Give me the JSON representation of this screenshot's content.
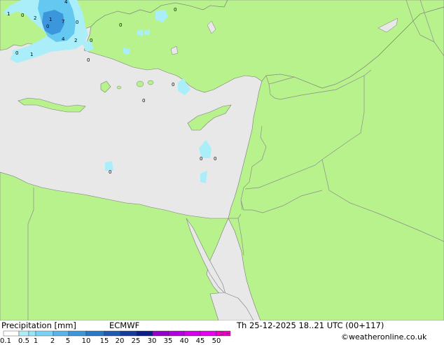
{
  "colors": {
    "land": "#b8f28c",
    "sea": "#e8e8e8",
    "border": "#8c8c8c",
    "coast": "#7a7a7a",
    "precip_light": "#aaeefa",
    "precip_mid": "#64c8f0",
    "precip_heavy": "#3c96dc"
  },
  "point_values": [
    {
      "text": "1"
    },
    {
      "text": "0"
    },
    {
      "text": "4"
    },
    {
      "text": "0"
    },
    {
      "text": "2"
    },
    {
      "text": "7"
    },
    {
      "text": "0"
    },
    {
      "text": "1"
    },
    {
      "text": "4"
    },
    {
      "text": "2"
    },
    {
      "text": "0"
    },
    {
      "text": "0"
    },
    {
      "text": "0"
    },
    {
      "text": "1"
    },
    {
      "text": "0"
    },
    {
      "text": "0"
    },
    {
      "text": "0"
    },
    {
      "text": "0"
    },
    {
      "text": "0"
    },
    {
      "text": "0"
    },
    {
      "text": "0"
    }
  ],
  "legend": {
    "title": "Precipitation [mm]",
    "model": "ECMWF",
    "datetime": "Th 25-12-2025 18..21 UTC (00+117)",
    "credit": "©weatheronline.co.uk",
    "ticks": [
      "0.1",
      "0.5",
      "1",
      "2",
      "5",
      "10",
      "15",
      "20",
      "25",
      "30",
      "35",
      "40",
      "45",
      "50"
    ],
    "colors": [
      "#fffffe",
      "#aaeefa",
      "#96e6f8",
      "#78d2f4",
      "#5ab4ec",
      "#3c96dc",
      "#2878c8",
      "#1e5ab4",
      "#143ca0",
      "#0a1e8c",
      "#9600c8",
      "#b400dc",
      "#d200e6",
      "#e600f0",
      "#f000c8"
    ]
  }
}
